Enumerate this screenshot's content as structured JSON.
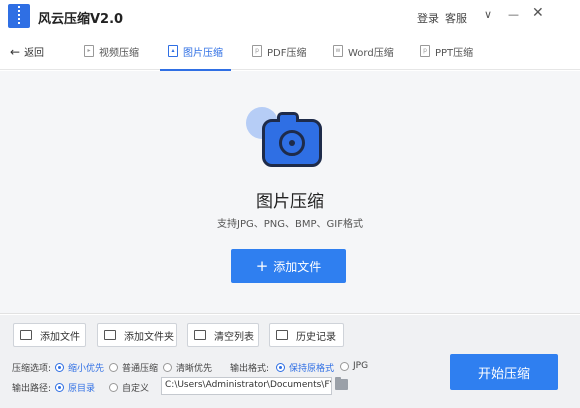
{
  "app": {
    "title": "风云压缩V2.0"
  },
  "titlebar": {
    "login": "登录",
    "service": "客服",
    "menu_icon": "chevron-down-icon",
    "min_icon": "minimize-icon",
    "close_icon": "close-icon"
  },
  "nav": {
    "back": "返回",
    "tabs": [
      {
        "label": "视频压缩",
        "icon": "video-file-icon"
      },
      {
        "label": "图片压缩",
        "icon": "image-file-icon",
        "active": true
      },
      {
        "label": "PDF压缩",
        "icon": "pdf-file-icon"
      },
      {
        "label": "Word压缩",
        "icon": "word-file-icon"
      },
      {
        "label": "PPT压缩",
        "icon": "ppt-file-icon"
      }
    ]
  },
  "main": {
    "title": "图片压缩",
    "subtitle": "支持JPG、PNG、BMP、GIF格式",
    "add_button": "添加文件"
  },
  "toolbar": {
    "add_file": "添加文件",
    "add_folder": "添加文件夹",
    "clear_list": "清空列表",
    "history": "历史记录"
  },
  "options": {
    "compress_label": "压缩选项:",
    "compress_modes": [
      {
        "label": "缩小优先",
        "selected": true
      },
      {
        "label": "普通压缩",
        "selected": false
      },
      {
        "label": "清晰优先",
        "selected": false
      }
    ],
    "format_label": "输出格式:",
    "formats": [
      {
        "label": "保持原格式",
        "selected": true
      },
      {
        "label": "JPG",
        "selected": false
      }
    ],
    "path_label": "输出路径:",
    "path_modes": [
      {
        "label": "原目录",
        "selected": true
      },
      {
        "label": "自定义",
        "selected": false
      }
    ],
    "path_value": "C:\\Users\\Administrator\\Documents\\FYCom"
  },
  "start_button": "开始压缩",
  "colors": {
    "accent": "#2f7ff0",
    "active_tab": "#2f6fe4"
  }
}
